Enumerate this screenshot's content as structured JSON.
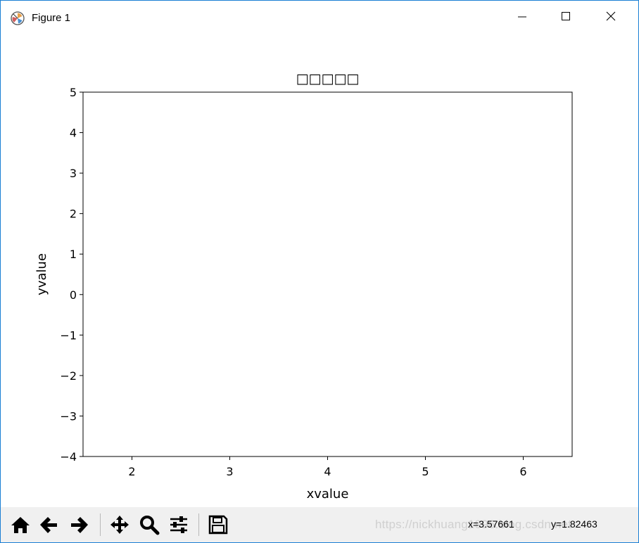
{
  "window": {
    "title": "Figure 1",
    "app_icon": "matplotlib-icon",
    "controls": [
      "minimize-icon",
      "maximize-icon",
      "close-icon"
    ]
  },
  "chart_data": {
    "type": "line",
    "title": "□□□□□",
    "xlabel": "xvalue",
    "ylabel": "yvalue",
    "xlim": [
      1.5,
      6.5
    ],
    "ylim": [
      -4,
      5
    ],
    "xticks": [
      2,
      3,
      4,
      5,
      6
    ],
    "yticks": [
      5,
      4,
      3,
      2,
      1,
      0,
      -1,
      -2,
      -3,
      -4
    ],
    "xtick_labels": [
      "2",
      "3",
      "4",
      "5",
      "6"
    ],
    "ytick_labels": [
      "5",
      "4",
      "3",
      "2",
      "1",
      "0",
      "−1",
      "−2",
      "−3",
      "−4"
    ],
    "series": [],
    "grid": false
  },
  "toolbar": {
    "buttons": [
      "home-icon",
      "back-icon",
      "forward-icon",
      "pan-icon",
      "zoom-icon",
      "configure-subplots-icon",
      "save-icon"
    ],
    "coord_x": "x=3.57661",
    "coord_y": "y=1.82463",
    "watermark": "https://nickhuang1996.blog.csdn.net"
  }
}
